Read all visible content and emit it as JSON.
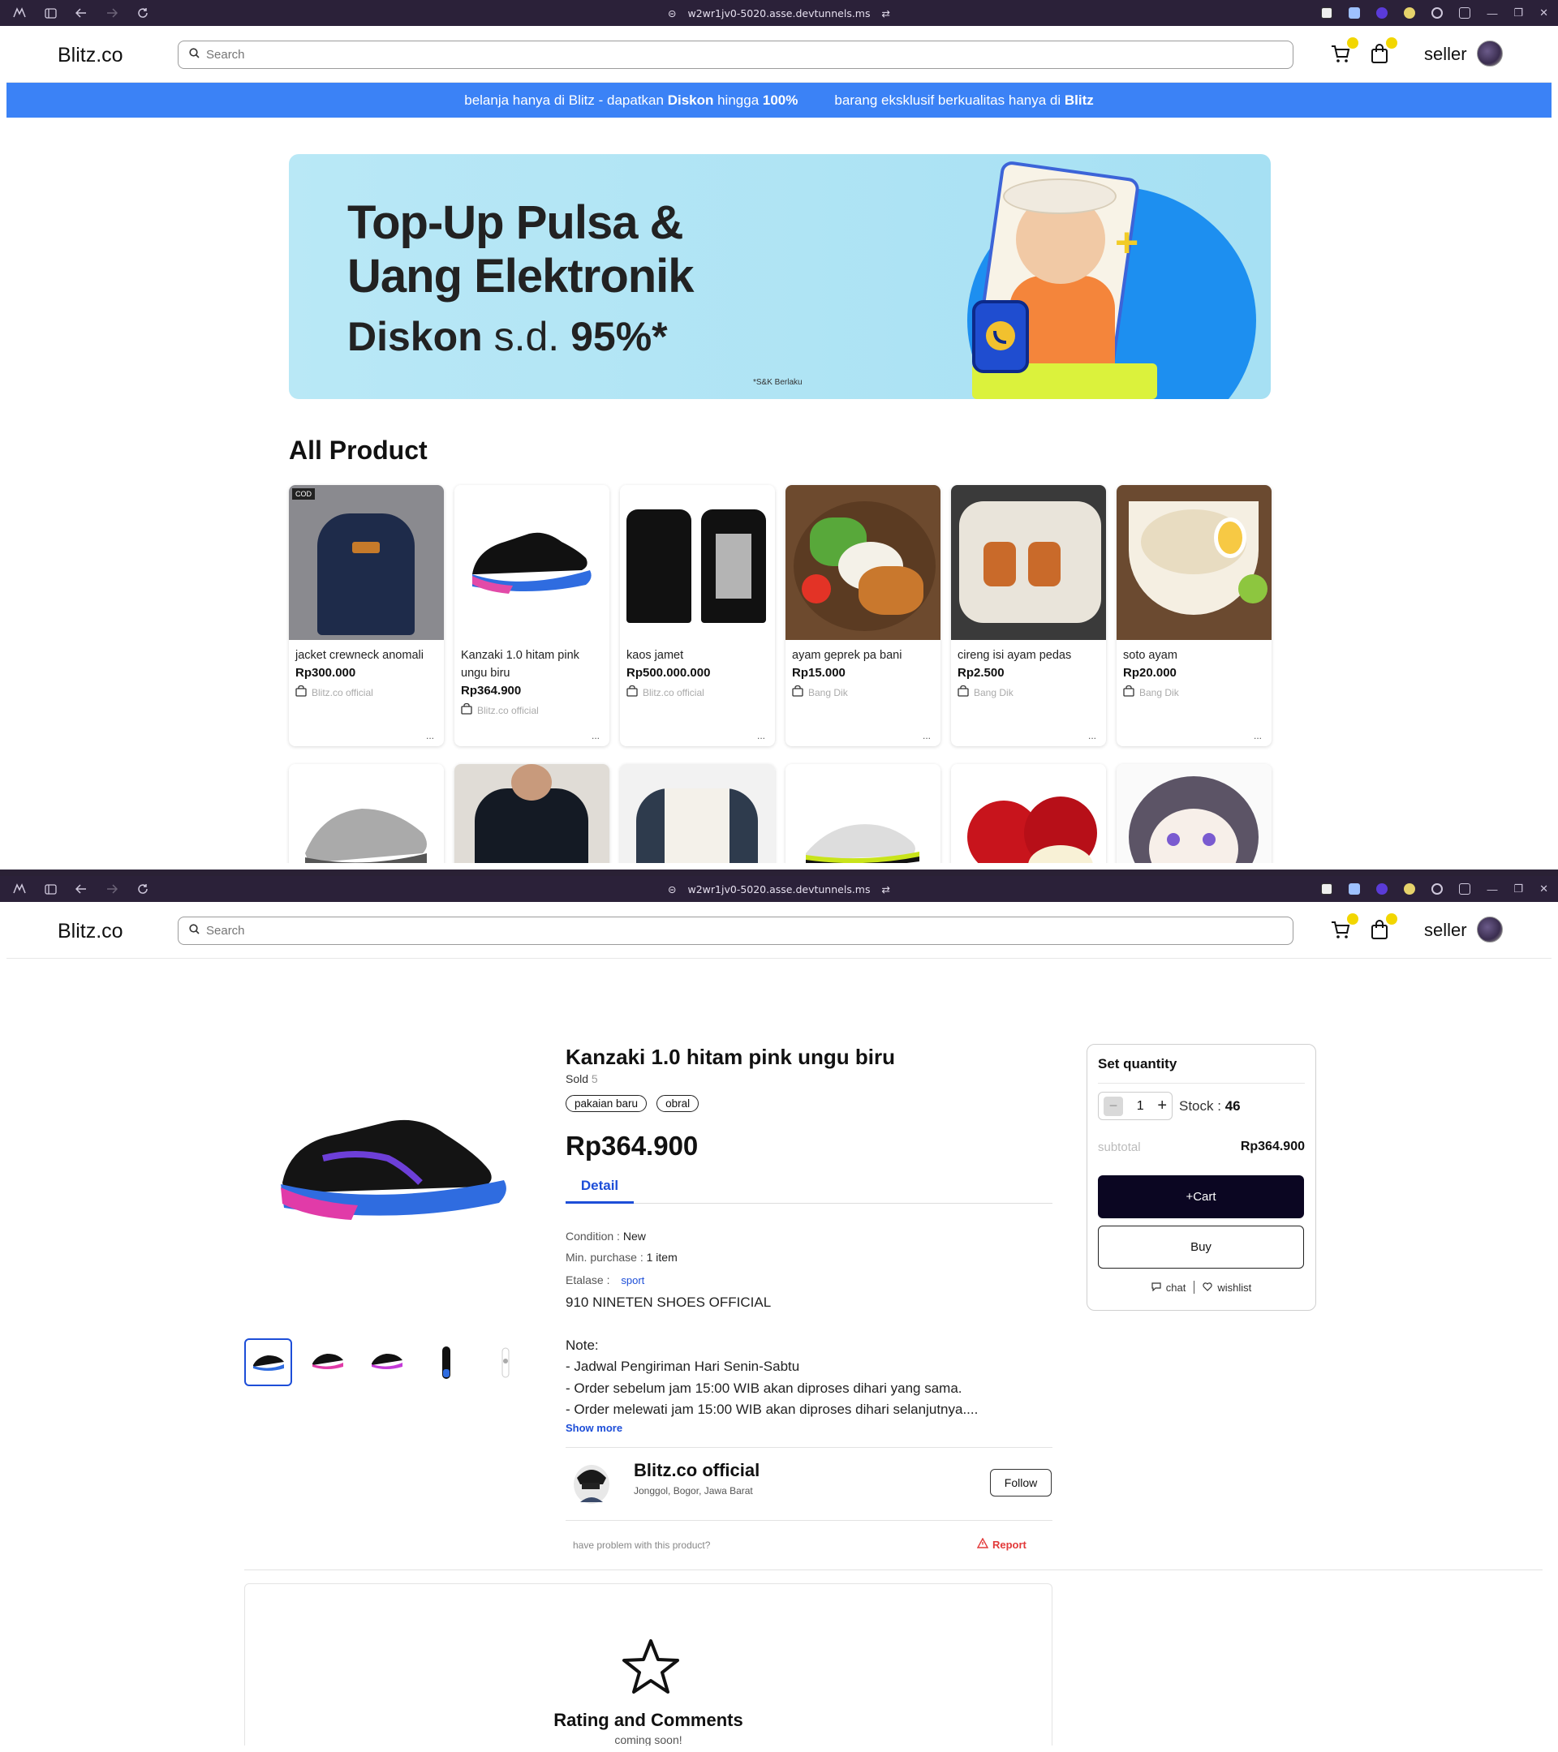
{
  "browser": {
    "url": "w2wr1jv0-5020.asse.devtunnels.ms"
  },
  "header": {
    "logo": "Blitz.co",
    "search_placeholder": "Search",
    "user_label": "seller"
  },
  "promo_bar": {
    "left_pre": "belanja hanya di Blitz - dapatkan ",
    "left_b1": "Diskon",
    "left_mid": " hingga ",
    "left_b2": "100%",
    "right_pre": "barang eksklusif berkualitas hanya di ",
    "right_b": "Blitz"
  },
  "banner": {
    "line1": "Top-Up Pulsa &",
    "line2": "Uang Elektronik",
    "line3_b": "Diskon",
    "line3_rest": " s.d. ",
    "line3_pct": "95%*",
    "terms": "*S&K Berlaku"
  },
  "catalog": {
    "title": "All Product",
    "products": [
      {
        "name": "jacket crewneck anomali",
        "price": "Rp300.000",
        "shop": "Blitz.co official",
        "more": "..."
      },
      {
        "name": "Kanzaki 1.0 hitam pink ungu biru",
        "price": "Rp364.900",
        "shop": "Blitz.co official",
        "more": "..."
      },
      {
        "name": "kaos jamet",
        "price": "Rp500.000.000",
        "shop": "Blitz.co official",
        "more": "..."
      },
      {
        "name": "ayam geprek pa bani",
        "price": "Rp15.000",
        "shop": "Bang Dik",
        "more": "..."
      },
      {
        "name": "cireng isi ayam pedas",
        "price": "Rp2.500",
        "shop": "Bang Dik",
        "more": "..."
      },
      {
        "name": "soto ayam",
        "price": "Rp20.000",
        "shop": "Bang Dik",
        "more": "..."
      }
    ]
  },
  "product": {
    "title": "Kanzaki 1.0 hitam pink ungu biru",
    "sold_label": "Sold",
    "sold_count": "5",
    "tags": [
      "pakaian baru",
      "obral"
    ],
    "price": "Rp364.900",
    "tab": "Detail",
    "condition_label": "Condition : ",
    "condition": "New",
    "min_label": "Min. purchase : ",
    "min": "1 item",
    "etalase_label": "Etalase : ",
    "etalase": "sport",
    "desc_lines": [
      "910 NINETEN SHOES OFFICIAL",
      "",
      "Note:",
      "- Jadwal Pengiriman Hari Senin-Sabtu",
      "- Order sebelum jam 15:00 WIB akan diproses dihari yang sama.",
      "- Order melewati jam 15:00 WIB akan diproses dihari selanjutnya...."
    ],
    "show_more": "Show more"
  },
  "shop": {
    "name": "Blitz.co official",
    "location": "Jonggol, Bogor, Jawa Barat",
    "follow": "Follow"
  },
  "report": {
    "question": "have problem with this product?",
    "label": "Report"
  },
  "rating": {
    "title": "Rating and Comments",
    "subtitle": "coming soon!"
  },
  "quantity": {
    "title": "Set quantity",
    "minus": "−",
    "value": "1",
    "plus": "+",
    "stock_label": "Stock : ",
    "stock": "46",
    "subtotal_label": "subtotal",
    "subtotal": "Rp364.900",
    "cart_btn": "+Cart",
    "buy_btn": "Buy",
    "chat": "chat",
    "wishlist": "wishlist"
  }
}
